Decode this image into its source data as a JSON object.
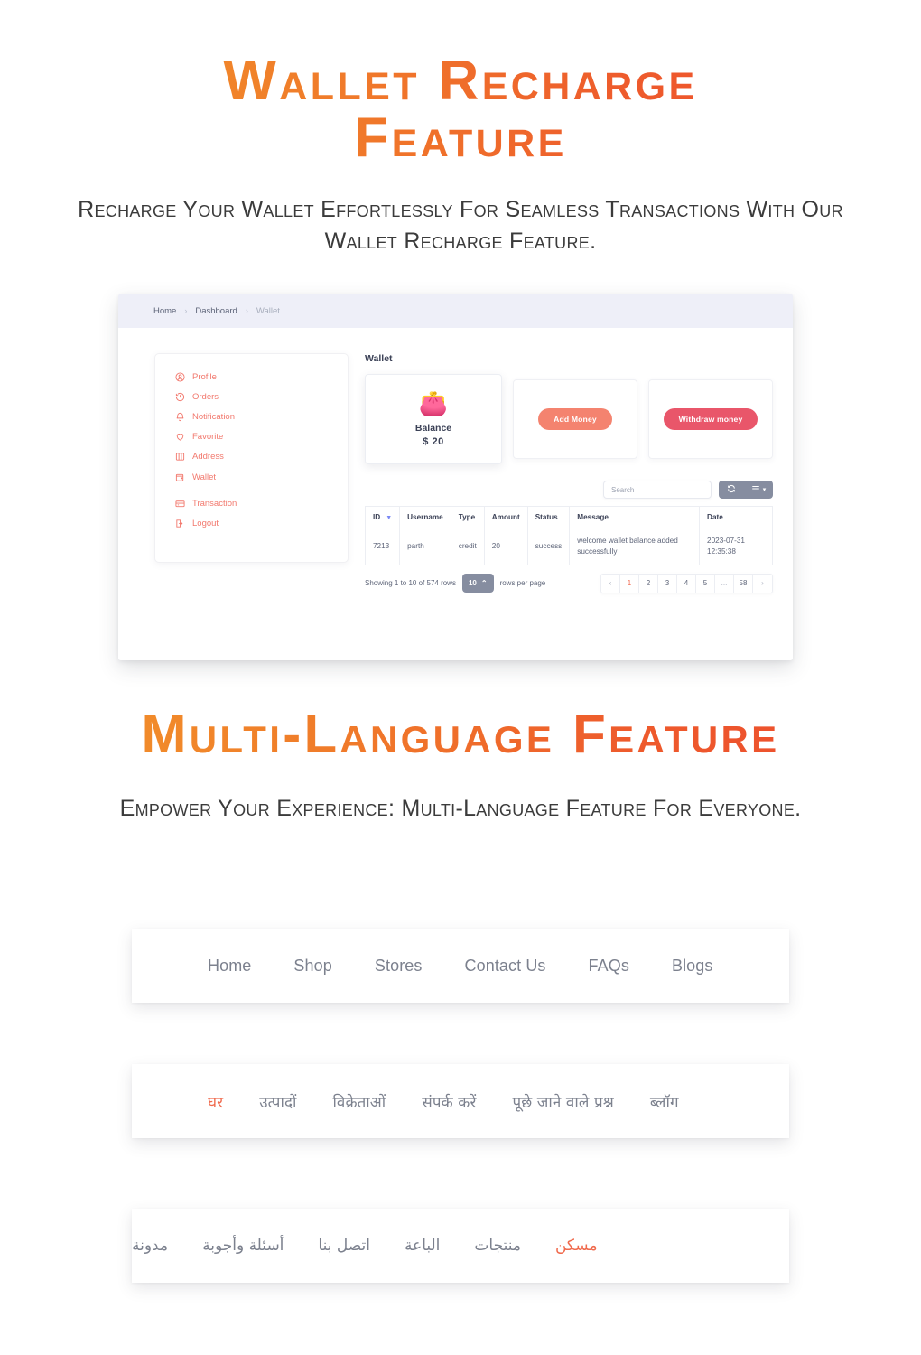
{
  "headings": {
    "title_1": "Wallet Recharge Feature",
    "subtitle_1": "Recharge Your Wallet Effortlessly For Seamless Transactions With Our Wallet Recharge Feature.",
    "title_2": "Multi-Language Feature",
    "subtitle_2": "Empower Your Experience: Multi-Language Feature For Everyone."
  },
  "colors": {
    "title_gradient_start": "#F2962B",
    "title_gradient_end": "#EC4A2E",
    "accent_coral": "#F4836F",
    "accent_red": "#E9566A",
    "sidebar_text": "#F2796E",
    "nav_active": "#F06A4D",
    "toolbar_gray": "#868DA0",
    "breadcrumb_bg": "#EEEFF8"
  },
  "dashboard": {
    "breadcrumb": [
      {
        "label": "Home",
        "muted": false
      },
      {
        "label": "Dashboard",
        "muted": false
      },
      {
        "label": "Wallet",
        "muted": true
      }
    ],
    "breadcrumb_separator": "›",
    "account_menu": [
      {
        "label": "Profile",
        "icon": "user-circle-icon"
      },
      {
        "label": "Orders",
        "icon": "history-icon"
      },
      {
        "label": "Notification",
        "icon": "bell-icon"
      },
      {
        "label": "Favorite",
        "icon": "heart-icon"
      },
      {
        "label": "Address",
        "icon": "book-icon"
      },
      {
        "label": "Wallet",
        "icon": "wallet-icon"
      },
      {
        "label": "Transaction",
        "icon": "card-icon"
      },
      {
        "label": "Logout",
        "icon": "logout-icon"
      }
    ],
    "wallet_heading": "Wallet",
    "balance_card": {
      "emoji": "👛",
      "icon_name": "wallet-emoji",
      "label": "Balance",
      "amount": "$ 20"
    },
    "add_money_label": "Add Money",
    "withdraw_money_label": "Withdraw money",
    "search_placeholder": "Search",
    "toolbar_icons": {
      "refresh": "refresh-icon",
      "columns": "columns-icon",
      "caret": "▾"
    },
    "table": {
      "columns": [
        "ID",
        "Username",
        "Type",
        "Amount",
        "Status",
        "Message",
        "Date"
      ],
      "sort_indicator": "▼",
      "rows": [
        {
          "id": "7213",
          "username": "parth",
          "type": "credit",
          "amount": "20",
          "status": "success",
          "message": "welcome wallet balance added successfully",
          "date": "2023-07-31 12:35:38"
        }
      ]
    },
    "pagination": {
      "showing_text": "Showing 1 to 10 of 574 rows",
      "rows_per_page_value": "10",
      "rows_per_page_caret": "⌃",
      "rows_per_page_label": "rows per page",
      "prev": "‹",
      "next": "›",
      "pages": [
        "1",
        "2",
        "3",
        "4",
        "5",
        "...",
        "58"
      ],
      "active_page": "1"
    }
  },
  "nav_english": {
    "name": "english-navbar",
    "items": [
      {
        "label": "Home",
        "active": false
      },
      {
        "label": "Shop",
        "active": false
      },
      {
        "label": "Stores",
        "active": false
      },
      {
        "label": "Contact Us",
        "active": false
      },
      {
        "label": "FAQs",
        "active": false
      },
      {
        "label": "Blogs",
        "active": false
      }
    ]
  },
  "nav_hindi": {
    "name": "hindi-navbar",
    "items": [
      {
        "label": "घर",
        "active": true
      },
      {
        "label": "उत्पादों",
        "active": false
      },
      {
        "label": "विक्रेताओं",
        "active": false
      },
      {
        "label": "संपर्क करें",
        "active": false
      },
      {
        "label": "पूछे जाने वाले प्रश्न",
        "active": false
      },
      {
        "label": "ब्लॉग",
        "active": false
      }
    ]
  },
  "nav_arabic": {
    "name": "arabic-navbar",
    "items": [
      {
        "label": "مسكن",
        "active": true
      },
      {
        "label": "منتجات",
        "active": false
      },
      {
        "label": "الباعة",
        "active": false
      },
      {
        "label": "اتصل بنا",
        "active": false
      },
      {
        "label": "أسئلة وأجوبة",
        "active": false
      },
      {
        "label": "مدونة",
        "active": false
      }
    ]
  }
}
